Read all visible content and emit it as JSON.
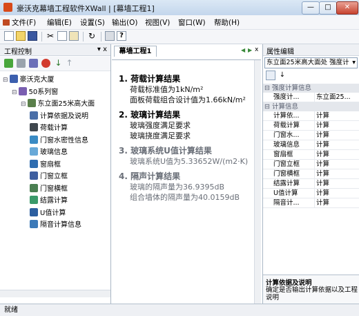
{
  "window": {
    "title": "豪沃克幕墙工程软件XWall | [幕墙工程1]",
    "min": "—",
    "max": "□",
    "close": "✕"
  },
  "menu": [
    "文件(F)",
    "编辑(E)",
    "设置(S)",
    "输出(O)",
    "视图(V)",
    "窗口(W)",
    "帮助(H)"
  ],
  "left_panel": {
    "title": "工程控制",
    "pin": "▾ x",
    "tree": [
      {
        "label": "豪沃克大厦",
        "level": 0,
        "expander": "⊟",
        "icon": "building-icon"
      },
      {
        "label": "50系列窗",
        "level": 1,
        "expander": "⊟",
        "icon": "series-icon"
      },
      {
        "label": "东立面25米高大面",
        "level": 2,
        "expander": "⊟",
        "icon": "facade-icon"
      },
      {
        "label": "计算依据及说明",
        "level": 3,
        "icon": "doc-icon"
      },
      {
        "label": "荷载计算",
        "level": 3,
        "icon": "load-icon"
      },
      {
        "label": "门窗水密性信息",
        "level": 3,
        "icon": "door-icon"
      },
      {
        "label": "玻璃信息",
        "level": 3,
        "icon": "glass-icon"
      },
      {
        "label": "窗扇框",
        "level": 3,
        "icon": "sash-icon"
      },
      {
        "label": "门窗立框",
        "level": 3,
        "icon": "mullion-icon"
      },
      {
        "label": "门窗横框",
        "level": 3,
        "icon": "transom-icon"
      },
      {
        "label": "结露计算",
        "level": 3,
        "icon": "dew-icon"
      },
      {
        "label": "U值计算",
        "level": 3,
        "icon": "uvalue-icon"
      },
      {
        "label": "隔音计算信息",
        "level": 3,
        "icon": "sound-icon"
      }
    ]
  },
  "document": {
    "tab": "幕墙工程1",
    "nav_prev": "◀",
    "nav_next": "▶",
    "close": "x",
    "sections": [
      {
        "heading": "1.  荷载计算结果",
        "lines": [
          "荷载标准值为1kN/m²",
          "面板荷载组合设计值为1.66kN/m²"
        ]
      },
      {
        "heading": "2.  玻璃计算结果",
        "lines": [
          "玻璃强度满足要求",
          "玻璃挠度满足要求"
        ]
      },
      {
        "heading": "3.  玻璃系统U值计算结果",
        "lines": [
          "玻璃系统U值为5.33652W/(m2·K)"
        ]
      },
      {
        "heading": "4.  隔声计算结果",
        "lines": [
          "玻璃的隔声量为36.9395dB",
          "组合墙体的隔声量为40.0159dB"
        ]
      }
    ]
  },
  "properties": {
    "title": "属性编辑",
    "selector": "东立面25米高大面处 强度计",
    "categories": [
      {
        "name": "强度计算信息",
        "rows": [
          {
            "name": "强度计...",
            "value": "东立面25..."
          }
        ]
      },
      {
        "name": "计算信息",
        "rows": [
          {
            "name": "计算依...",
            "value": "计算"
          },
          {
            "name": "荷载计算",
            "value": "计算"
          },
          {
            "name": "门窗水...",
            "value": "计算"
          },
          {
            "name": "玻璃信息",
            "value": "计算"
          },
          {
            "name": "窗扇框",
            "value": "计算"
          },
          {
            "name": "门窗立框",
            "value": "计算"
          },
          {
            "name": "门窗横框",
            "value": "计算"
          },
          {
            "name": "结露计算",
            "value": "计算"
          },
          {
            "name": "U值计算",
            "value": "计算"
          },
          {
            "name": "隔音计...",
            "value": "计算"
          }
        ]
      }
    ],
    "desc_title": "计算依据及说明",
    "desc_text": "确定是否输出计算依据以及工程说明"
  },
  "status": "就绪"
}
